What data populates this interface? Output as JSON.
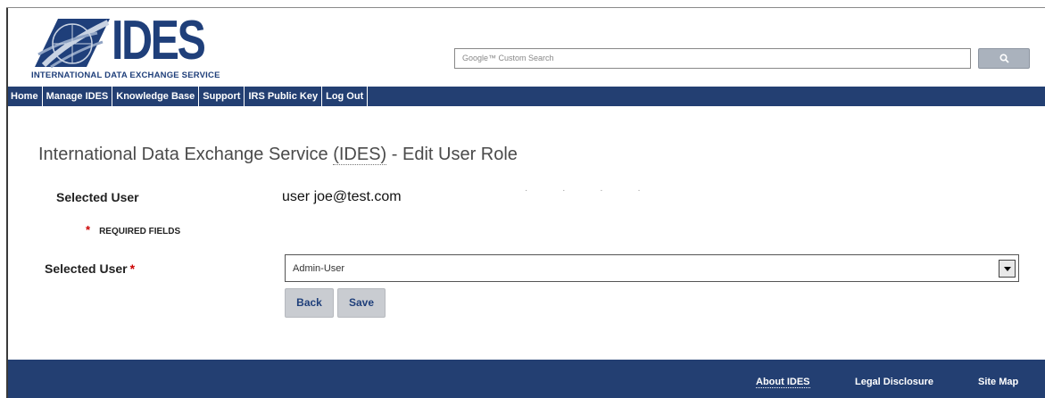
{
  "header": {
    "logo_text": "IDES",
    "logo_subtitle": "INTERNATIONAL DATA EXCHANGE SERVICE",
    "search_placeholder": "Google™ Custom Search"
  },
  "nav": {
    "items": [
      {
        "label": "Home"
      },
      {
        "label": "Manage IDES"
      },
      {
        "label": "Knowledge Base"
      },
      {
        "label": "Support"
      },
      {
        "label": "IRS Public Key"
      },
      {
        "label": "Log Out"
      }
    ]
  },
  "main": {
    "title_prefix": "International Data Exchange Service ",
    "title_abbr": "(IDES)",
    "title_suffix": " - Edit User Role",
    "selected_user_label": "Selected User",
    "selected_user_value": "user joe@test.com",
    "required_star": "*",
    "required_text": "REQUIRED FIELDS",
    "role_label": "Selected User",
    "role_star": "*",
    "role_selected": "Admin-User",
    "back_label": "Back",
    "save_label": "Save"
  },
  "footer": {
    "about": "About IDES",
    "legal": "Legal Disclosure",
    "sitemap": "Site Map"
  },
  "colors": {
    "nav_bg": "#233f72",
    "brand_blue": "#1f3f7a",
    "required_red": "#cc0000",
    "button_gray": "#c9ccd1"
  }
}
